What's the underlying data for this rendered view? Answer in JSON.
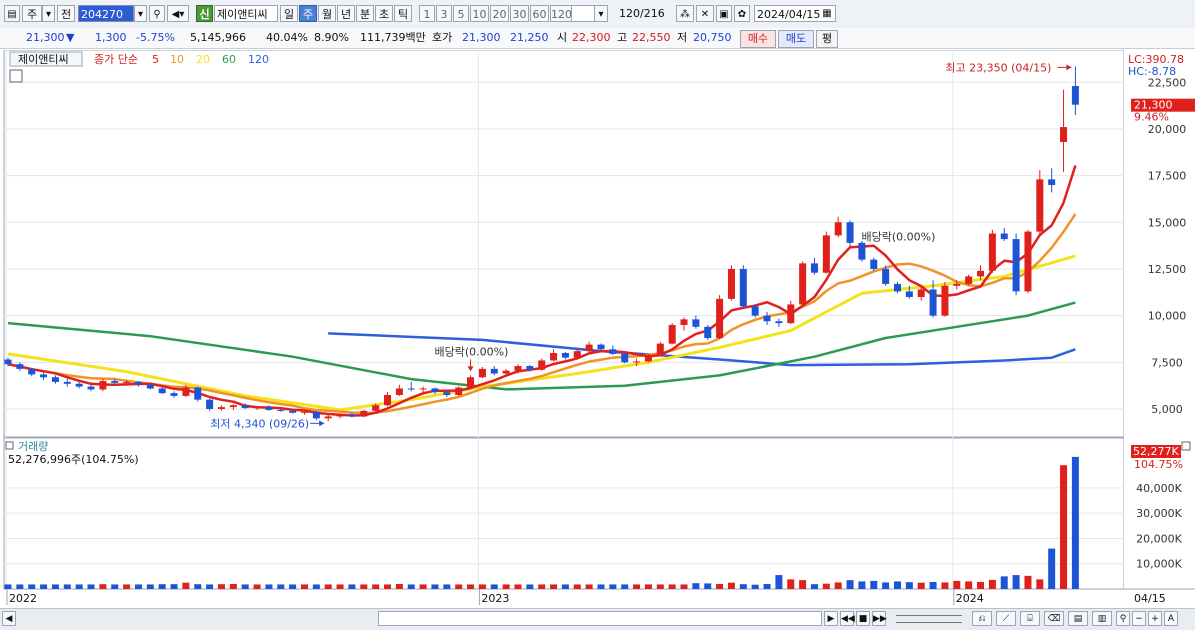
{
  "toolbar": {
    "mode_label": "주",
    "compare_label": "전",
    "code": "204270",
    "stock_name": "제이앤티씨",
    "credit_badge": "신",
    "periods": [
      {
        "label": "일",
        "active": false
      },
      {
        "label": "주",
        "active": true
      },
      {
        "label": "월",
        "active": false
      },
      {
        "label": "년",
        "active": false
      },
      {
        "label": "분",
        "active": false
      },
      {
        "label": "초",
        "active": false
      },
      {
        "label": "틱",
        "active": false
      }
    ],
    "intervals": [
      "1",
      "3",
      "5",
      "10",
      "20",
      "30",
      "60",
      "120"
    ],
    "bar_count": "120",
    "bar_total": "/216",
    "date": "2024/04/15"
  },
  "info": {
    "price": "21,300",
    "change_arrow": "▼",
    "change": "1,300",
    "change_pct": "-5.75%",
    "volume": "5,145,966",
    "vol_ratio": "40.04%",
    "turnover": "8.90%",
    "amount": "111,739백만",
    "hoga_label": "호가",
    "ask": "21,300",
    "bid": "21,250",
    "open_label": "시",
    "open": "22,300",
    "high_label": "고",
    "high": "22,550",
    "low_label": "저",
    "low": "20,750",
    "buy_btn": "매수",
    "sell_btn": "매도",
    "eval_btn": "평"
  },
  "price_panel": {
    "name_tag": "제이앤티씨",
    "legend_prefix": "종가 단순",
    "ma_periods": [
      {
        "label": "5",
        "color": "#e02020"
      },
      {
        "label": "10",
        "color": "#f0922a"
      },
      {
        "label": "20",
        "color": "#f4e21c"
      },
      {
        "label": "60",
        "color": "#2c9a52"
      },
      {
        "label": "120",
        "color": "#2f5ee0"
      }
    ],
    "lc": "LC:390.78",
    "hc": "HC:-8.78",
    "current_price_tag": "21,300",
    "current_pct_tag": "9.46%",
    "high_annotation": "최고 23,350 (04/15)",
    "low_annotation": "최저 4,340 (09/26)",
    "dividend_labels": [
      "배당락(0.00%)",
      "배당락(0.00%)"
    ],
    "y_ticks": [
      "22,500",
      "20,000",
      "17,500",
      "15,000",
      "12,500",
      "10,000",
      "7,500",
      "5,000"
    ]
  },
  "volume_panel": {
    "title": "거래량",
    "value": "52,276,996주(104.75%)",
    "current_tag": "52,277K",
    "current_pct": "104.75%",
    "y_ticks": [
      "40,000K",
      "30,000K",
      "20,000K",
      "10,000K"
    ]
  },
  "x_axis": {
    "labels": [
      "2022",
      "2023",
      "2024"
    ],
    "right_label": "04/15"
  },
  "chart_data": {
    "type": "candlestick",
    "period": "weekly",
    "price_range": [
      3500,
      23800
    ],
    "volume_range": [
      0,
      55000
    ],
    "candles": [
      {
        "o": 7650,
        "h": 7750,
        "l": 7300,
        "c": 7400
      },
      {
        "o": 7400,
        "h": 7500,
        "l": 7050,
        "c": 7150
      },
      {
        "o": 7150,
        "h": 7200,
        "l": 6750,
        "c": 6850
      },
      {
        "o": 6850,
        "h": 6950,
        "l": 6550,
        "c": 6700
      },
      {
        "o": 6700,
        "h": 6800,
        "l": 6350,
        "c": 6450
      },
      {
        "o": 6450,
        "h": 6600,
        "l": 6200,
        "c": 6350
      },
      {
        "o": 6350,
        "h": 6450,
        "l": 6100,
        "c": 6200
      },
      {
        "o": 6200,
        "h": 6300,
        "l": 5950,
        "c": 6050
      },
      {
        "o": 6050,
        "h": 6600,
        "l": 5950,
        "c": 6500
      },
      {
        "o": 6500,
        "h": 6600,
        "l": 6300,
        "c": 6400
      },
      {
        "o": 6400,
        "h": 6550,
        "l": 6250,
        "c": 6450
      },
      {
        "o": 6450,
        "h": 6500,
        "l": 6200,
        "c": 6300
      },
      {
        "o": 6300,
        "h": 6350,
        "l": 6050,
        "c": 6100
      },
      {
        "o": 6100,
        "h": 6150,
        "l": 5800,
        "c": 5850
      },
      {
        "o": 5850,
        "h": 5950,
        "l": 5600,
        "c": 5700
      },
      {
        "o": 5700,
        "h": 6300,
        "l": 5650,
        "c": 6150
      },
      {
        "o": 6150,
        "h": 6200,
        "l": 5400,
        "c": 5500
      },
      {
        "o": 5500,
        "h": 5550,
        "l": 4900,
        "c": 5000
      },
      {
        "o": 5000,
        "h": 5200,
        "l": 4900,
        "c": 5100
      },
      {
        "o": 5100,
        "h": 5250,
        "l": 4950,
        "c": 5200
      },
      {
        "o": 5200,
        "h": 5300,
        "l": 5000,
        "c": 5050
      },
      {
        "o": 5050,
        "h": 5150,
        "l": 4950,
        "c": 5100
      },
      {
        "o": 5100,
        "h": 5200,
        "l": 4900,
        "c": 4950
      },
      {
        "o": 4950,
        "h": 5050,
        "l": 4850,
        "c": 4900
      },
      {
        "o": 4900,
        "h": 5000,
        "l": 4750,
        "c": 4800
      },
      {
        "o": 4800,
        "h": 4950,
        "l": 4700,
        "c": 4850
      },
      {
        "o": 4850,
        "h": 4900,
        "l": 4400,
        "c": 4500
      },
      {
        "o": 4500,
        "h": 4700,
        "l": 4340,
        "c": 4600
      },
      {
        "o": 4600,
        "h": 4750,
        "l": 4500,
        "c": 4700
      },
      {
        "o": 4700,
        "h": 4800,
        "l": 4550,
        "c": 4600
      },
      {
        "o": 4600,
        "h": 4950,
        "l": 4550,
        "c": 4900
      },
      {
        "o": 4900,
        "h": 5300,
        "l": 4850,
        "c": 5200
      },
      {
        "o": 5200,
        "h": 5900,
        "l": 5150,
        "c": 5750
      },
      {
        "o": 5750,
        "h": 6300,
        "l": 5700,
        "c": 6100
      },
      {
        "o": 6100,
        "h": 6450,
        "l": 5950,
        "c": 6050
      },
      {
        "o": 6050,
        "h": 6200,
        "l": 5850,
        "c": 6100
      },
      {
        "o": 6100,
        "h": 6150,
        "l": 5800,
        "c": 5900
      },
      {
        "o": 5900,
        "h": 6000,
        "l": 5650,
        "c": 5750
      },
      {
        "o": 5750,
        "h": 6200,
        "l": 5700,
        "c": 6150
      },
      {
        "o": 6150,
        "h": 6800,
        "l": 6100,
        "c": 6700
      },
      {
        "o": 6700,
        "h": 7250,
        "l": 6650,
        "c": 7150
      },
      {
        "o": 7150,
        "h": 7300,
        "l": 6800,
        "c": 6900
      },
      {
        "o": 6900,
        "h": 7150,
        "l": 6750,
        "c": 7050
      },
      {
        "o": 7050,
        "h": 7400,
        "l": 6900,
        "c": 7300
      },
      {
        "o": 7300,
        "h": 7350,
        "l": 7000,
        "c": 7100
      },
      {
        "o": 7100,
        "h": 7700,
        "l": 7050,
        "c": 7600
      },
      {
        "o": 7600,
        "h": 8200,
        "l": 7550,
        "c": 8000
      },
      {
        "o": 8000,
        "h": 8050,
        "l": 7650,
        "c": 7750
      },
      {
        "o": 7750,
        "h": 8200,
        "l": 7700,
        "c": 8100
      },
      {
        "o": 8100,
        "h": 8600,
        "l": 8000,
        "c": 8450
      },
      {
        "o": 8450,
        "h": 8500,
        "l": 8100,
        "c": 8200
      },
      {
        "o": 8200,
        "h": 8400,
        "l": 7900,
        "c": 7950
      },
      {
        "o": 7950,
        "h": 8000,
        "l": 7450,
        "c": 7500
      },
      {
        "o": 7500,
        "h": 7700,
        "l": 7300,
        "c": 7550
      },
      {
        "o": 7550,
        "h": 7950,
        "l": 7500,
        "c": 7900
      },
      {
        "o": 7900,
        "h": 8600,
        "l": 7850,
        "c": 8500
      },
      {
        "o": 8500,
        "h": 9600,
        "l": 8450,
        "c": 9500
      },
      {
        "o": 9500,
        "h": 9900,
        "l": 9200,
        "c": 9800
      },
      {
        "o": 9800,
        "h": 10000,
        "l": 9300,
        "c": 9400
      },
      {
        "o": 9400,
        "h": 9500,
        "l": 8700,
        "c": 8800
      },
      {
        "o": 8800,
        "h": 11100,
        "l": 8750,
        "c": 10900
      },
      {
        "o": 10900,
        "h": 12700,
        "l": 10800,
        "c": 12500
      },
      {
        "o": 12500,
        "h": 12700,
        "l": 10400,
        "c": 10500
      },
      {
        "o": 10500,
        "h": 10600,
        "l": 9900,
        "c": 10000
      },
      {
        "o": 10000,
        "h": 10200,
        "l": 9500,
        "c": 9700
      },
      {
        "o": 9700,
        "h": 9850,
        "l": 9400,
        "c": 9600
      },
      {
        "o": 9600,
        "h": 10800,
        "l": 9550,
        "c": 10600
      },
      {
        "o": 10600,
        "h": 12900,
        "l": 10550,
        "c": 12800
      },
      {
        "o": 12800,
        "h": 13100,
        "l": 12200,
        "c": 12300
      },
      {
        "o": 12300,
        "h": 14500,
        "l": 12250,
        "c": 14300
      },
      {
        "o": 14300,
        "h": 15300,
        "l": 14200,
        "c": 15000
      },
      {
        "o": 15000,
        "h": 15100,
        "l": 13700,
        "c": 13900
      },
      {
        "o": 13900,
        "h": 14000,
        "l": 12900,
        "c": 13000
      },
      {
        "o": 13000,
        "h": 13100,
        "l": 12400,
        "c": 12500
      },
      {
        "o": 12500,
        "h": 12700,
        "l": 11600,
        "c": 11700
      },
      {
        "o": 11700,
        "h": 11800,
        "l": 11200,
        "c": 11300
      },
      {
        "o": 11300,
        "h": 11600,
        "l": 10900,
        "c": 11000
      },
      {
        "o": 11000,
        "h": 11500,
        "l": 10800,
        "c": 11400
      },
      {
        "o": 11400,
        "h": 11900,
        "l": 9900,
        "c": 10000
      },
      {
        "o": 10000,
        "h": 11800,
        "l": 9950,
        "c": 11600
      },
      {
        "o": 11600,
        "h": 11900,
        "l": 11400,
        "c": 11700
      },
      {
        "o": 11700,
        "h": 12200,
        "l": 11600,
        "c": 12100
      },
      {
        "o": 12100,
        "h": 12700,
        "l": 11900,
        "c": 12400
      },
      {
        "o": 12400,
        "h": 14600,
        "l": 12300,
        "c": 14400
      },
      {
        "o": 14400,
        "h": 14700,
        "l": 14000,
        "c": 14100
      },
      {
        "o": 14100,
        "h": 14400,
        "l": 11100,
        "c": 11300
      },
      {
        "o": 11300,
        "h": 14600,
        "l": 11200,
        "c": 14500
      },
      {
        "o": 14500,
        "h": 17800,
        "l": 14400,
        "c": 17300
      },
      {
        "o": 17300,
        "h": 17900,
        "l": 16600,
        "c": 17000
      },
      {
        "o": 19300,
        "h": 22100,
        "l": 17700,
        "c": 20100
      },
      {
        "o": 22300,
        "h": 23350,
        "l": 20750,
        "c": 21300
      }
    ],
    "volumes": [
      1800,
      1800,
      1800,
      1800,
      1800,
      1800,
      1800,
      1800,
      1900,
      1800,
      1800,
      1800,
      1800,
      1900,
      1900,
      3200,
      1900,
      1800,
      1900,
      2000,
      1800,
      1800,
      1800,
      1800,
      1800,
      1800,
      1800,
      1800,
      1800,
      1800,
      1800,
      1800,
      1800,
      1800,
      1800,
      1800,
      1800,
      1800,
      1800,
      1800,
      1800,
      1800,
      1800,
      1800,
      1800,
      1800,
      1800,
      1800,
      1800,
      1800,
      1800,
      1800,
      1800,
      1800,
      1800,
      1800,
      1800,
      1800,
      1800,
      1800,
      1800,
      1800,
      1800,
      1800,
      1800,
      1800,
      1800,
      1800,
      1800,
      1800,
      1800,
      1800,
      1800,
      1800,
      1800,
      1800,
      1800,
      1800,
      1800,
      1800,
      1800,
      1800,
      1800,
      1800,
      1800,
      1800,
      1800,
      1800,
      1800,
      1800,
      1800
    ],
    "volumes_override": {
      "15": 2500,
      "33": 2000,
      "34": 1800,
      "58": 2300,
      "59": 2200,
      "60": 2000,
      "61": 2500,
      "62": 1900,
      "63": 1700,
      "64": 2000,
      "65": 5500,
      "66": 3800,
      "67": 3500,
      "68": 1900,
      "69": 2100,
      "70": 2600,
      "71": 3500,
      "72": 3000,
      "73": 3200,
      "74": 2600,
      "75": 3000,
      "76": 2700,
      "77": 2500,
      "78": 2800,
      "79": 2600,
      "80": 3200,
      "81": 3000,
      "82": 2800,
      "83": 3600,
      "84": 5000,
      "85": 5500,
      "86": 5200,
      "87": 3800,
      "88": 16000,
      "89": 49000,
      "90": 52277
    },
    "ma120": [
      {
        "i": 27,
        "v": 9050
      },
      {
        "i": 40,
        "v": 8700
      },
      {
        "i": 50,
        "v": 8100
      },
      {
        "i": 60,
        "v": 7650
      },
      {
        "i": 66,
        "v": 7350
      },
      {
        "i": 76,
        "v": 7400
      },
      {
        "i": 84,
        "v": 7600
      },
      {
        "i": 88,
        "v": 7750
      },
      {
        "i": 90,
        "v": 8200
      }
    ],
    "ma60": [
      {
        "i": 0,
        "v": 9600
      },
      {
        "i": 12,
        "v": 8900
      },
      {
        "i": 24,
        "v": 7800
      },
      {
        "i": 34,
        "v": 6600
      },
      {
        "i": 42,
        "v": 6050
      },
      {
        "i": 52,
        "v": 6250
      },
      {
        "i": 60,
        "v": 6800
      },
      {
        "i": 68,
        "v": 7800
      },
      {
        "i": 74,
        "v": 8800
      },
      {
        "i": 80,
        "v": 9400
      },
      {
        "i": 86,
        "v": 10000
      },
      {
        "i": 90,
        "v": 10700
      }
    ],
    "ma20": [
      {
        "i": 0,
        "v": 7950
      },
      {
        "i": 10,
        "v": 7000
      },
      {
        "i": 20,
        "v": 5700
      },
      {
        "i": 28,
        "v": 4950
      },
      {
        "i": 34,
        "v": 5500
      },
      {
        "i": 40,
        "v": 6200
      },
      {
        "i": 48,
        "v": 6900
      },
      {
        "i": 54,
        "v": 7500
      },
      {
        "i": 60,
        "v": 8300
      },
      {
        "i": 66,
        "v": 9200
      },
      {
        "i": 72,
        "v": 11200
      },
      {
        "i": 78,
        "v": 11600
      },
      {
        "i": 84,
        "v": 12100
      },
      {
        "i": 90,
        "v": 13200
      }
    ]
  }
}
